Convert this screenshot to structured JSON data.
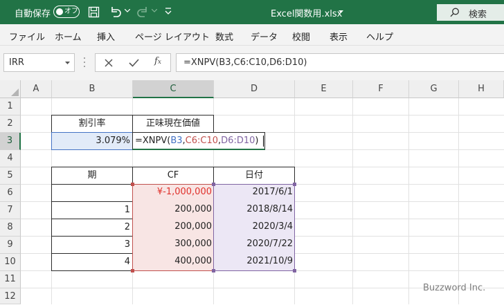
{
  "titlebar": {
    "autosave_label": "自動保存",
    "autosave_state": "オフ",
    "filename": "Excel関数用.xlsx",
    "search_label": "検索"
  },
  "menu": [
    "ファイル",
    "ホーム",
    "挿入",
    "ページ レイアウト",
    "数式",
    "データ",
    "校閲",
    "表示",
    "ヘルプ"
  ],
  "formula_bar": {
    "name_box": "IRR",
    "formula": "=XNPV(B3,C6:C10,D6:D10)"
  },
  "columns": [
    "A",
    "B",
    "C",
    "D",
    "E",
    "F",
    "G",
    "H"
  ],
  "rows": [
    "1",
    "2",
    "3",
    "4",
    "5",
    "6",
    "7",
    "8",
    "9",
    "10",
    "11",
    "12"
  ],
  "cells": {
    "B2": "割引率",
    "C2": "正味現在価値",
    "B3": "3.079%",
    "C3_prefix": "=XNPV(",
    "C3_ref1": "B3",
    "C3_sep1": ",",
    "C3_ref2": "C6:C10",
    "C3_sep2": ",",
    "C3_ref3": "D6:D10",
    "C3_suffix": ")",
    "B5": "期",
    "C5": "CF",
    "D5": "日付",
    "B6": "",
    "C6": "¥-1,000,000",
    "D6": "2017/6/1",
    "B7": "1",
    "C7": "200,000",
    "D7": "2018/8/14",
    "B8": "2",
    "C8": "200,000",
    "D8": "2020/3/4",
    "B9": "3",
    "C9": "300,000",
    "D9": "2020/7/22",
    "B10": "4",
    "C10": "400,000",
    "D10": "2021/10/9"
  },
  "colors": {
    "brand": "#217346",
    "ref_b3": "#4472c4",
    "ref_c": "#c0504d",
    "ref_d": "#8064a2"
  },
  "watermark": "Buzzword Inc."
}
